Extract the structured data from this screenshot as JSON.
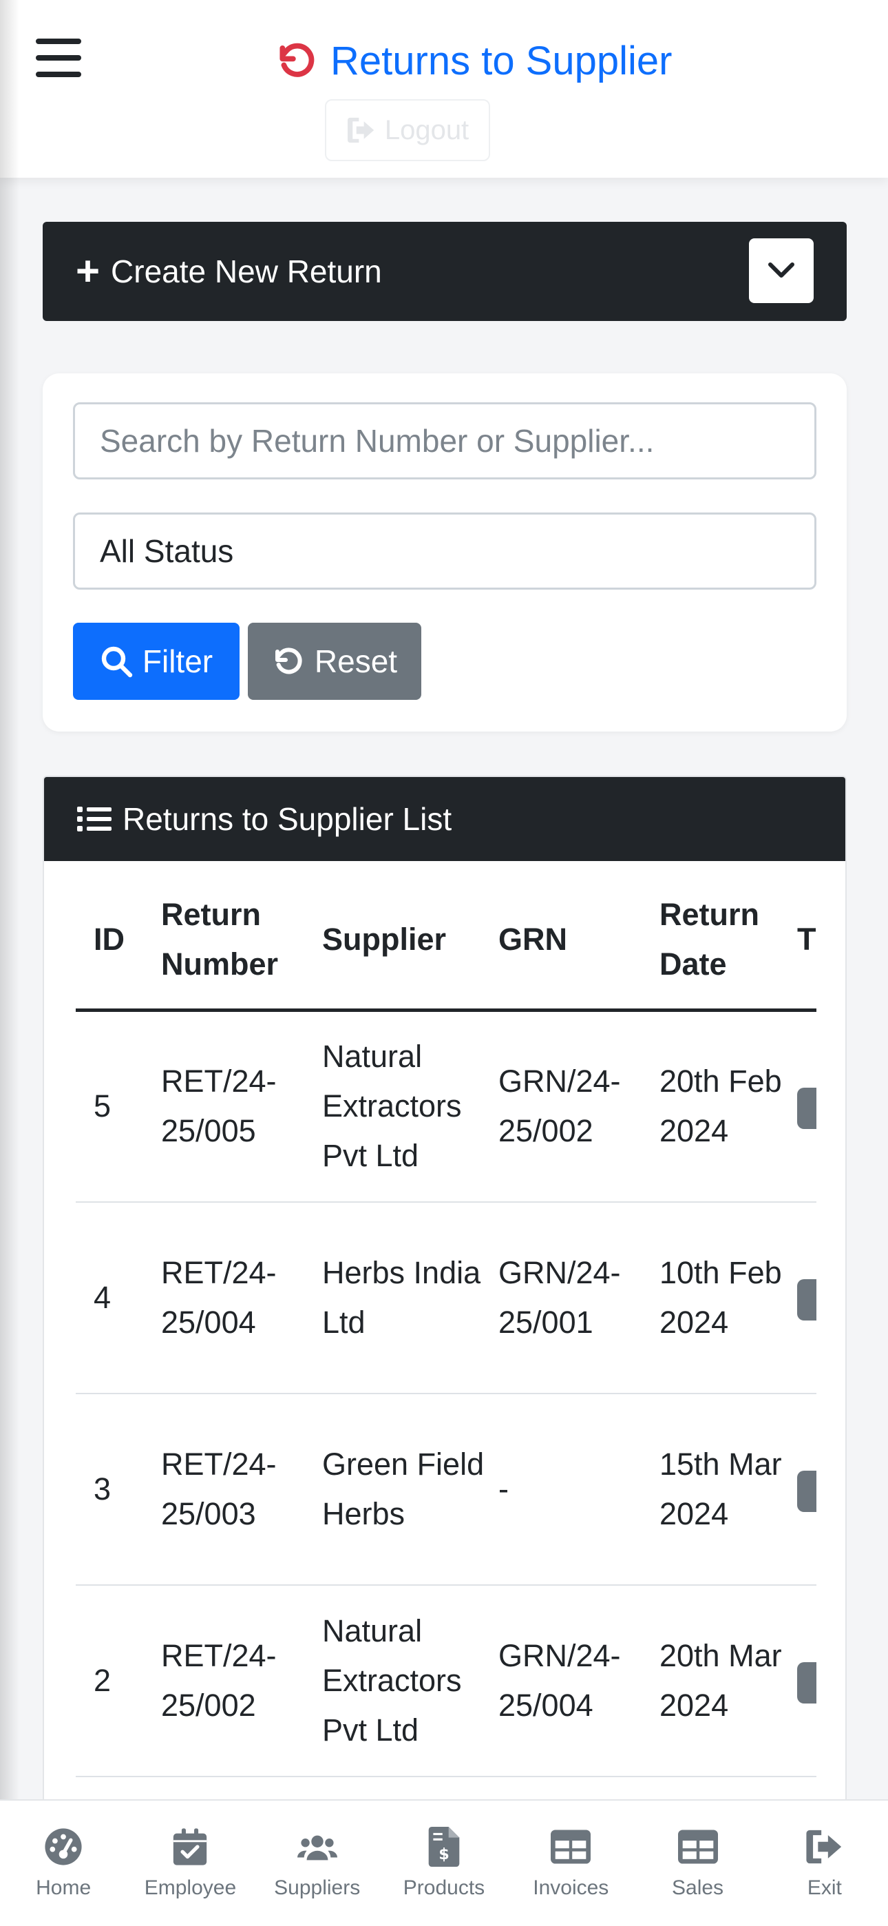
{
  "header": {
    "title": "Returns to Supplier",
    "title_icon": "undo-icon",
    "logout_label": "Logout",
    "accent_color": "#0d6efd",
    "icon_color": "#dc3545"
  },
  "create_panel": {
    "label": "Create New Return",
    "toggle_icon": "chevron-down-icon"
  },
  "filters": {
    "search_placeholder": "Search by Return Number or Supplier...",
    "status_value": "All Status",
    "filter_label": "Filter",
    "reset_label": "Reset"
  },
  "list": {
    "title": "Returns to Supplier List",
    "columns": [
      "ID",
      "Return Number",
      "Supplier",
      "GRN",
      "Return Date",
      "T"
    ],
    "rows": [
      {
        "id": "5",
        "return_number": "RET/24-25/005",
        "supplier": "Natural Extractors Pvt Ltd",
        "grn": "GRN/24-25/002",
        "return_date": "20th Feb 2024"
      },
      {
        "id": "4",
        "return_number": "RET/24-25/004",
        "supplier": "Herbs India Ltd",
        "grn": "GRN/24-25/001",
        "return_date": "10th Feb 2024"
      },
      {
        "id": "3",
        "return_number": "RET/24-25/003",
        "supplier": "Green Field Herbs",
        "grn": "-",
        "return_date": "15th Mar 2024"
      },
      {
        "id": "2",
        "return_number": "RET/24-25/002",
        "supplier": "Natural Extractors Pvt Ltd",
        "grn": "GRN/24-25/004",
        "return_date": "20th Mar 2024"
      }
    ]
  },
  "bottom_nav": [
    {
      "label": "Home",
      "icon": "dashboard-gauge-icon"
    },
    {
      "label": "Employee",
      "icon": "calendar-check-icon"
    },
    {
      "label": "Suppliers",
      "icon": "users-icon"
    },
    {
      "label": "Products",
      "icon": "invoice-dollar-icon"
    },
    {
      "label": "Invoices",
      "icon": "table-icon"
    },
    {
      "label": "Sales",
      "icon": "table-icon"
    },
    {
      "label": "Exit",
      "icon": "sign-out-icon"
    }
  ]
}
